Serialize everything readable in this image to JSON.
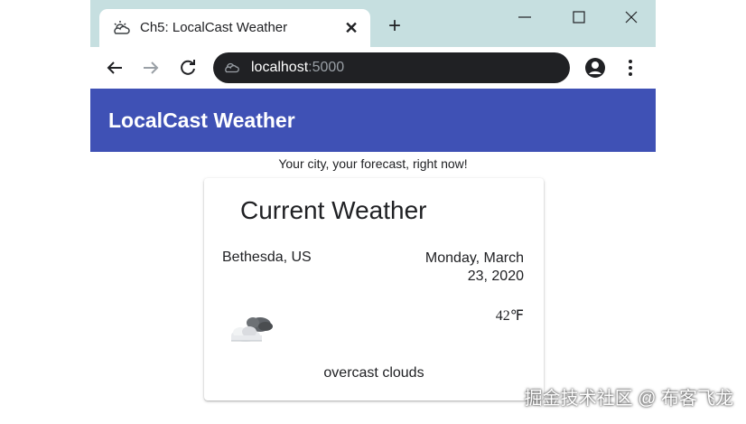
{
  "browser": {
    "tab": {
      "title": "Ch5: LocalCast Weather",
      "favicon": "weather-icon",
      "close_glyph": "✕"
    },
    "new_tab_glyph": "+",
    "address": {
      "host": "localhost",
      "port": ":5000"
    },
    "colors": {
      "tabstrip": "#c6dfe0",
      "omnibox": "#202124"
    }
  },
  "app": {
    "title": "LocalCast Weather",
    "tagline": "Your city, your forecast, right now!",
    "accent_color": "#3f51b5"
  },
  "weather_card": {
    "title": "Current Weather",
    "city": "Bethesda, US",
    "date": "Monday, March 23, 2020",
    "temperature": "42℉",
    "condition_icon": "overcast-clouds-icon",
    "description": "overcast clouds"
  },
  "watermark": "掘金技术社区 @ 布客飞龙"
}
